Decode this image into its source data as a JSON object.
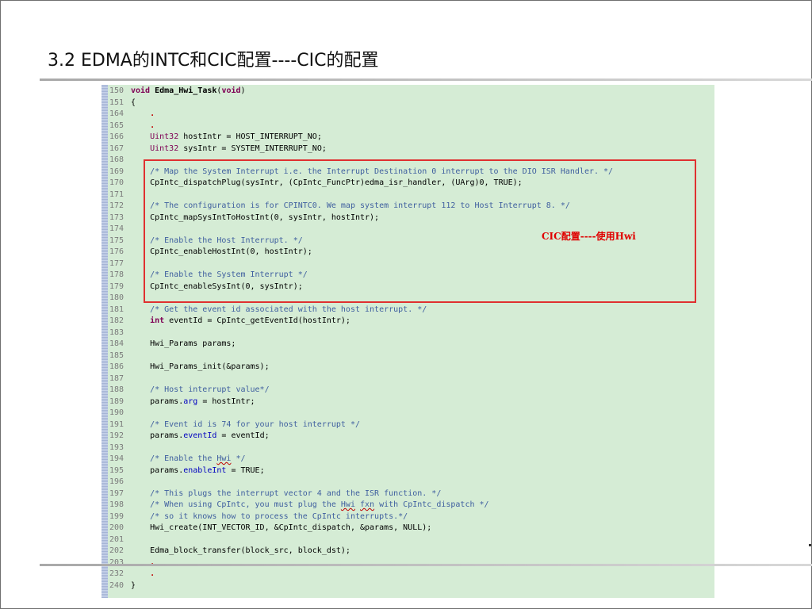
{
  "slide": {
    "title": "3.2 EDMA的INTC和CIC配置----CIC的配置"
  },
  "annotation": {
    "label": "CIC配置----使用Hwi"
  },
  "code": {
    "lines": [
      {
        "n": "150",
        "t": "void Edma_Hwi_Task(void)",
        "style": "sig"
      },
      {
        "n": "151",
        "t": "{"
      },
      {
        "n": "164",
        "t": "    .",
        "style": "dot"
      },
      {
        "n": "165",
        "t": "    .",
        "style": "dot"
      },
      {
        "n": "166",
        "t": "    Uint32 hostIntr = HOST_INTERRUPT_NO;",
        "style": "type"
      },
      {
        "n": "167",
        "t": "    Uint32 sysIntr = SYSTEM_INTERRUPT_NO;",
        "style": "type"
      },
      {
        "n": "168",
        "t": ""
      },
      {
        "n": "169",
        "t": "    /* Map the System Interrupt i.e. the Interrupt Destination 0 interrupt to the DIO ISR Handler. */",
        "style": "comment"
      },
      {
        "n": "170",
        "t": "    CpIntc_dispatchPlug(sysIntr, (CpIntc_FuncPtr)edma_isr_handler, (UArg)0, TRUE);"
      },
      {
        "n": "171",
        "t": ""
      },
      {
        "n": "172",
        "t": "    /* The configuration is for CPINTC0. We map system interrupt 112 to Host Interrupt 8. */",
        "style": "comment"
      },
      {
        "n": "173",
        "t": "    CpIntc_mapSysIntToHostInt(0, sysIntr, hostIntr);"
      },
      {
        "n": "174",
        "t": ""
      },
      {
        "n": "175",
        "t": "    /* Enable the Host Interrupt. */",
        "style": "comment"
      },
      {
        "n": "176",
        "t": "    CpIntc_enableHostInt(0, hostIntr);"
      },
      {
        "n": "177",
        "t": ""
      },
      {
        "n": "178",
        "t": "    /* Enable the System Interrupt */",
        "style": "comment"
      },
      {
        "n": "179",
        "t": "    CpIntc_enableSysInt(0, sysIntr);"
      },
      {
        "n": "180",
        "t": ""
      },
      {
        "n": "181",
        "t": "    /* Get the event id associated with the host interrupt. */",
        "style": "comment"
      },
      {
        "n": "182",
        "t": "    int eventId = CpIntc_getEventId(hostIntr);",
        "style": "int"
      },
      {
        "n": "183",
        "t": ""
      },
      {
        "n": "184",
        "t": "    Hwi_Params params;"
      },
      {
        "n": "185",
        "t": ""
      },
      {
        "n": "186",
        "t": "    Hwi_Params_init(&params);"
      },
      {
        "n": "187",
        "t": ""
      },
      {
        "n": "188",
        "t": "    /* Host interrupt value*/",
        "style": "comment"
      },
      {
        "n": "189",
        "t": "    params.arg = hostIntr;",
        "style": "field",
        "field": "arg"
      },
      {
        "n": "190",
        "t": ""
      },
      {
        "n": "191",
        "t": "    /* Event id is 74 for your host interrupt */",
        "style": "comment"
      },
      {
        "n": "192",
        "t": "    params.eventId = eventId;",
        "style": "field",
        "field": "eventId"
      },
      {
        "n": "193",
        "t": ""
      },
      {
        "n": "194",
        "t": "    /* Enable the Hwi */",
        "style": "comment"
      },
      {
        "n": "195",
        "t": "    params.enableInt = TRUE;",
        "style": "field",
        "field": "enableInt"
      },
      {
        "n": "196",
        "t": ""
      },
      {
        "n": "197",
        "t": "    /* This plugs the interrupt vector 4 and the ISR function. */",
        "style": "comment"
      },
      {
        "n": "198",
        "t": "    /* When using CpIntc, you must plug the Hwi fxn with CpIntc_dispatch */",
        "style": "comment"
      },
      {
        "n": "199",
        "t": "    /* so it knows how to process the CpIntc interrupts.*/",
        "style": "comment"
      },
      {
        "n": "200",
        "t": "    Hwi_create(INT_VECTOR_ID, &CpIntc_dispatch, &params, NULL);"
      },
      {
        "n": "201",
        "t": ""
      },
      {
        "n": "202",
        "t": "    Edma_block_transfer(block_src, block_dst);"
      },
      {
        "n": "203",
        "t": "    .",
        "style": "dot"
      },
      {
        "n": "232",
        "t": "    .",
        "style": "dot"
      },
      {
        "n": "240",
        "t": "}"
      }
    ]
  },
  "colors": {
    "panel_bg": "#d5ecd5",
    "keyword": "#7f0055",
    "comment": "#3f5f9f",
    "field": "#0000c0",
    "highlight_border": "#e03030",
    "annotation": "#e00000"
  }
}
